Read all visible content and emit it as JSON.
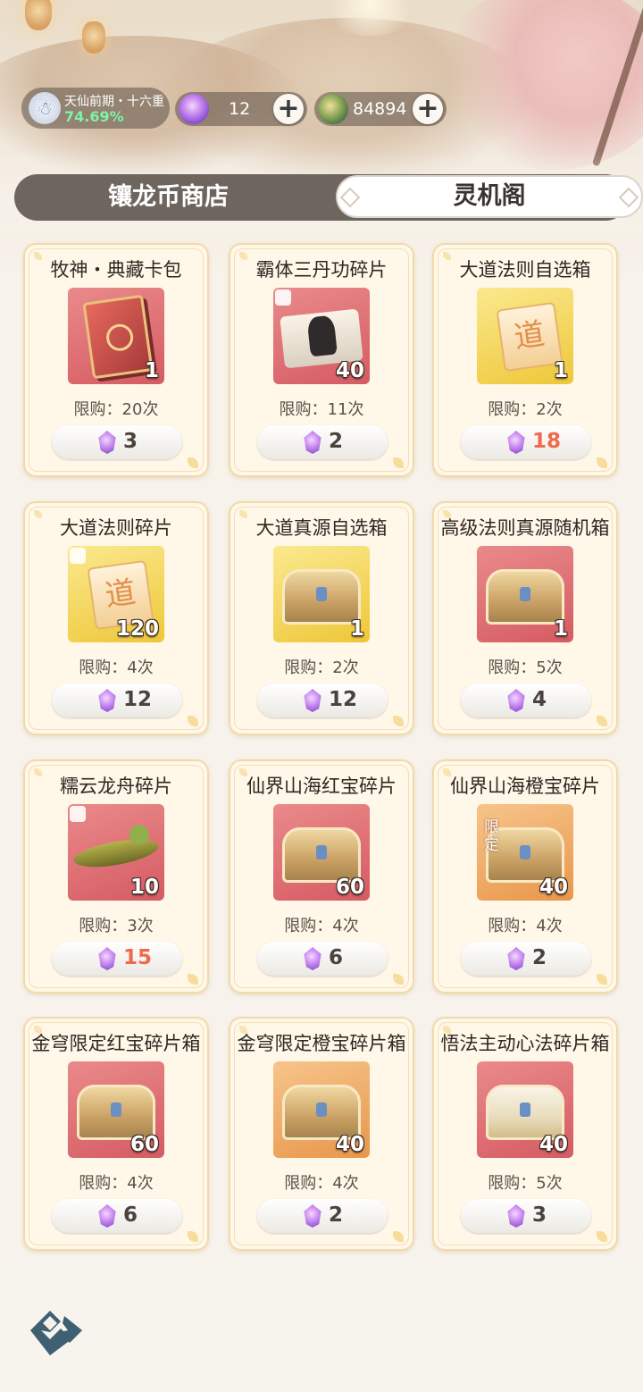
{
  "header": {
    "realm_title": "天仙前期・十六重",
    "realm_progress": "74.69%",
    "crystal_amount": "12",
    "jade_amount": "84894",
    "plus_label": "+"
  },
  "tabs": {
    "shop": "镶龙币商店",
    "active": "灵机阁"
  },
  "items": [
    {
      "name": "牧神・典藏卡包",
      "qty": "1",
      "limit": "限购：20次",
      "price": "3"
    },
    {
      "name": "霸体三丹功碎片",
      "qty": "40",
      "limit": "限购：11次",
      "price": "2"
    },
    {
      "name": "大道法则自选箱",
      "qty": "1",
      "limit": "限购：2次",
      "price": "18"
    },
    {
      "name": "大道法则碎片",
      "qty": "120",
      "limit": "限购：4次",
      "price": "12"
    },
    {
      "name": "大道真源自选箱",
      "qty": "1",
      "limit": "限购：2次",
      "price": "12"
    },
    {
      "name": "高级法则真源随机箱",
      "qty": "1",
      "limit": "限购：5次",
      "price": "4"
    },
    {
      "name": "糯云龙舟碎片",
      "qty": "10",
      "limit": "限购：3次",
      "price": "15"
    },
    {
      "name": "仙界山海红宝碎片",
      "qty": "60",
      "limit": "限购：4次",
      "price": "6"
    },
    {
      "name": "仙界山海橙宝碎片",
      "qty": "40",
      "limit": "限购：4次",
      "price": "2",
      "badge": "限定"
    },
    {
      "name": "金穹限定红宝碎片箱",
      "qty": "60",
      "limit": "限购：4次",
      "price": "6"
    },
    {
      "name": "金穹限定橙宝碎片箱",
      "qty": "40",
      "limit": "限购：4次",
      "price": "2"
    },
    {
      "name": "悟法主动心法碎片箱",
      "qty": "40",
      "limit": "限购：5次",
      "price": "3"
    }
  ],
  "dao_glyph": "道",
  "colors": {
    "price_highlight": "#ee6a4b",
    "progress_green": "#7ef3a8",
    "tab_bar": "#6e655f"
  }
}
